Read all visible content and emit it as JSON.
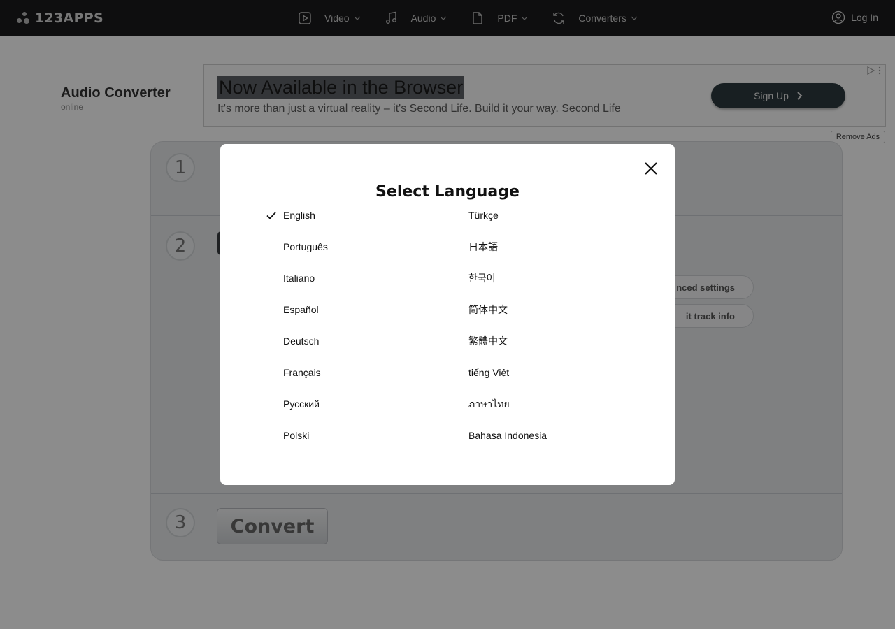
{
  "topbar": {
    "logo": "123APPS",
    "nav": [
      {
        "label": "Video",
        "icon": "video-icon"
      },
      {
        "label": "Audio",
        "icon": "music-note-icon"
      },
      {
        "label": "PDF",
        "icon": "document-icon"
      },
      {
        "label": "Converters",
        "icon": "refresh-icon"
      }
    ],
    "login": "Log In"
  },
  "brand": {
    "title": "Audio Converter",
    "subtitle": "online"
  },
  "ad": {
    "title": "Now Available in the Browser",
    "text": "It's more than just a virtual reality – it's Second Life. Build it your way. Second Life",
    "button": "Sign Up"
  },
  "remove_ads": "Remove Ads",
  "steps": {
    "one": "1",
    "two": "2",
    "three": "3",
    "advanced_settings": "nced settings",
    "edit_track_info": "it track info",
    "convert": "Convert"
  },
  "modal": {
    "title": "Select Language",
    "selected": "English",
    "left_languages": [
      "English",
      "Português",
      "Italiano",
      "Español",
      "Deutsch",
      "Français",
      "Русский",
      "Polski"
    ],
    "right_languages": [
      "Türkçe",
      "日本語",
      "한국어",
      "简体中文",
      "繁體中文",
      "tiếng Việt",
      "ภาษาไทย",
      "Bahasa Indonesia"
    ]
  }
}
